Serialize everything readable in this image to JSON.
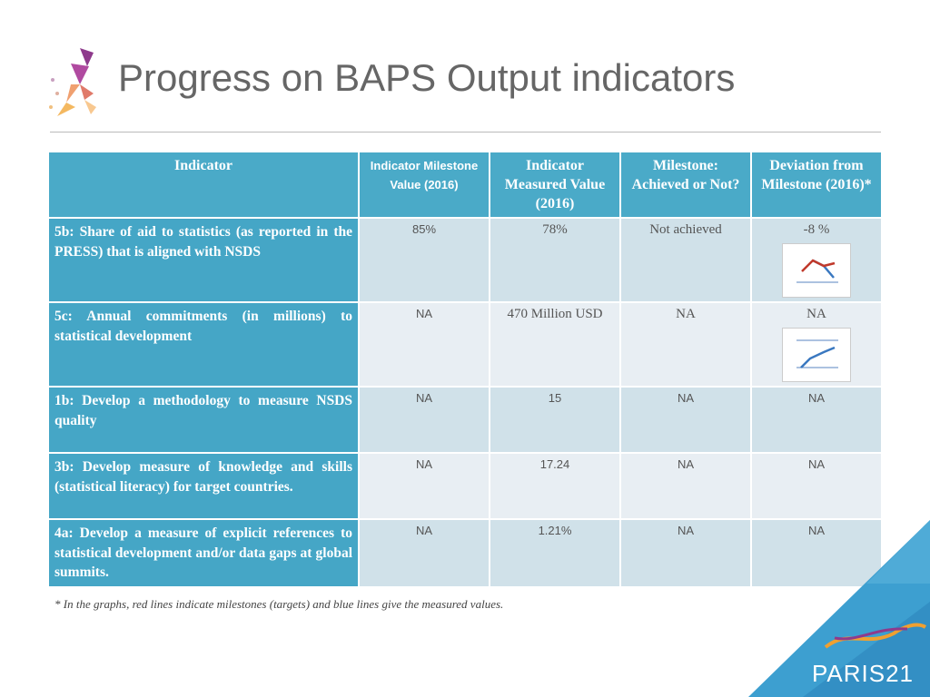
{
  "title": "Progress on BAPS Output indicators",
  "headers": [
    "Indicator",
    "Indicator Milestone Value (2016)",
    "Indicator Measured Value (2016)",
    "Milestone: Achieved or Not?",
    "Deviation from Milestone (2016)*"
  ],
  "rows": [
    {
      "indicator": "5b: Share of aid to statistics (as reported in the PRESS) that is aligned with NSDS",
      "milestone": "85%",
      "measured": "78%",
      "achieved": "Not achieved",
      "deviation": "-8 %",
      "sparkline": "red-milestone-blue-measured-decline"
    },
    {
      "indicator": "5c: Annual commitments (in millions) to statistical development",
      "milestone": "NA",
      "measured": "470 Million USD",
      "achieved": "NA",
      "deviation": "NA",
      "sparkline": "blue-measured-rising"
    },
    {
      "indicator": "1b: Develop a methodology to measure NSDS quality",
      "milestone": "NA",
      "measured": "15",
      "achieved": "NA",
      "deviation": "NA"
    },
    {
      "indicator": "3b: Develop measure of knowledge and skills (statistical literacy) for target countries.",
      "milestone": "NA",
      "measured": "17.24",
      "achieved": "NA",
      "deviation": "NA"
    },
    {
      "indicator": "4a: Develop a measure of explicit references to statistical development and/or data gaps at global summits.",
      "milestone": "NA",
      "measured": "1.21%",
      "achieved": "NA",
      "deviation": "NA"
    }
  ],
  "footnote": "* In the graphs, red lines indicate milestones (targets) and blue lines give the measured values.",
  "brand": "PARIS21",
  "colors": {
    "header": "#4aaac8",
    "indicator_col": "#45a6c6",
    "milestone_line": "#c0392b",
    "measured_line": "#3a78c0"
  }
}
